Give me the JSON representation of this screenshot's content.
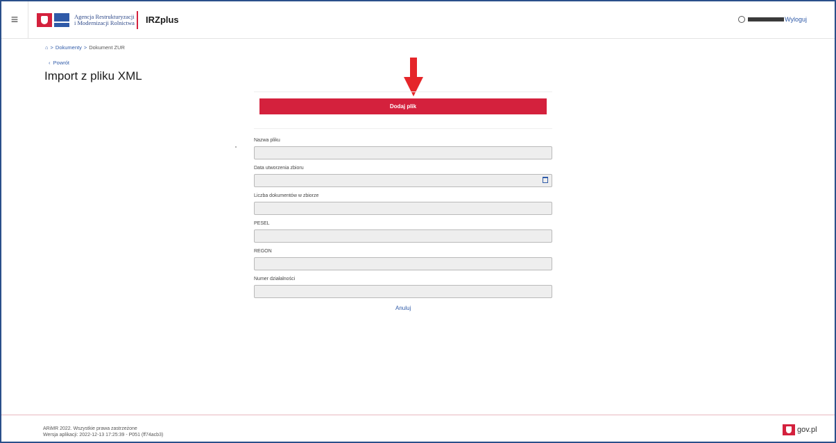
{
  "header": {
    "menu_icon": "hamburger-icon",
    "agency_line1": "Agencja Restrukturyzacji",
    "agency_line2": "i Modernizacji Rolnictwa",
    "app_name": "IRZplus",
    "logout_label": "Wyloguj"
  },
  "breadcrumb": {
    "home_icon": "home-icon",
    "items": [
      "Dokumenty",
      "Dokument ZUR"
    ]
  },
  "back_label": "Powrót",
  "page_title": "Import z pliku XML",
  "add_file_label": "Dodaj plik",
  "fields": [
    {
      "label": "Nazwa pliku",
      "value": ""
    },
    {
      "label": "Data utworzenia zbioru",
      "value": ""
    },
    {
      "label": "Liczba dokumentów w zbiorze",
      "value": ""
    },
    {
      "label": "PESEL",
      "value": ""
    },
    {
      "label": "REGON",
      "value": ""
    },
    {
      "label": "Numer działalności",
      "value": ""
    }
  ],
  "cancel_label": "Anuluj",
  "footer": {
    "copyright": "ARiMR 2022. Wszystkie prawa zastrzeżone",
    "version": "Wersja aplikacji: 2022-12-13 17:25:39 - P051 (ff74acb3)",
    "gov_label": "gov.pl"
  },
  "colors": {
    "accent_red": "#d4213d",
    "link_blue": "#2f5aa8",
    "frame_blue": "#2a4f8a"
  }
}
